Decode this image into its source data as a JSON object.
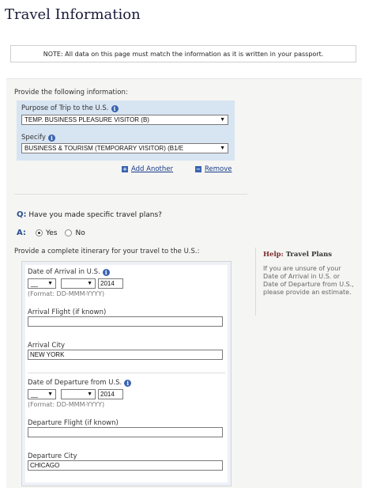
{
  "page": {
    "title": "Travel Information"
  },
  "note": "NOTE: All data on this page must match the information as it is written in your passport.",
  "provide_label": "Provide the following information:",
  "purpose": {
    "label": "Purpose of Trip to the U.S.",
    "value": "TEMP. BUSINESS PLEASURE VISITOR (B)"
  },
  "specify": {
    "label": "Specify",
    "value": "BUSINESS & TOURISM (TEMPORARY VISITOR) (B1/E"
  },
  "actions": {
    "add_another": "Add Another",
    "remove": "Remove"
  },
  "question": {
    "prefix": "Q:",
    "text": "Have you made specific travel plans?"
  },
  "answer": {
    "prefix": "A:",
    "yes": "Yes",
    "no": "No",
    "selected": "Yes"
  },
  "itinerary_label": "Provide a complete itinerary for your travel to the U.S.:",
  "arrival": {
    "date_label": "Date of Arrival in U.S.",
    "day": "__",
    "month": "",
    "year": "2014",
    "format_hint": "(Format: DD-MMM-YYYY)",
    "flight_label": "Arrival Flight (if known)",
    "flight_value": "",
    "city_label": "Arrival City",
    "city_value": "NEW YORK"
  },
  "departure": {
    "date_label": "Date of Departure from U.S.",
    "day": "__",
    "month": "",
    "year": "2014",
    "format_hint": "(Format: DD-MMM-YYYY)",
    "flight_label": "Departure Flight (if known)",
    "flight_value": "",
    "city_label": "Departure City",
    "city_value": "CHICAGO"
  },
  "help": {
    "prefix": "Help:",
    "title": "Travel Plans",
    "text": "If you are unsure of your Date of Arrival in U.S. or Date of Departure from U.S., please provide an estimate."
  },
  "icons": {
    "info": "info-icon",
    "add": "plus-square-icon",
    "remove": "minus-square-icon",
    "dropdown": "chevron-down-icon"
  }
}
